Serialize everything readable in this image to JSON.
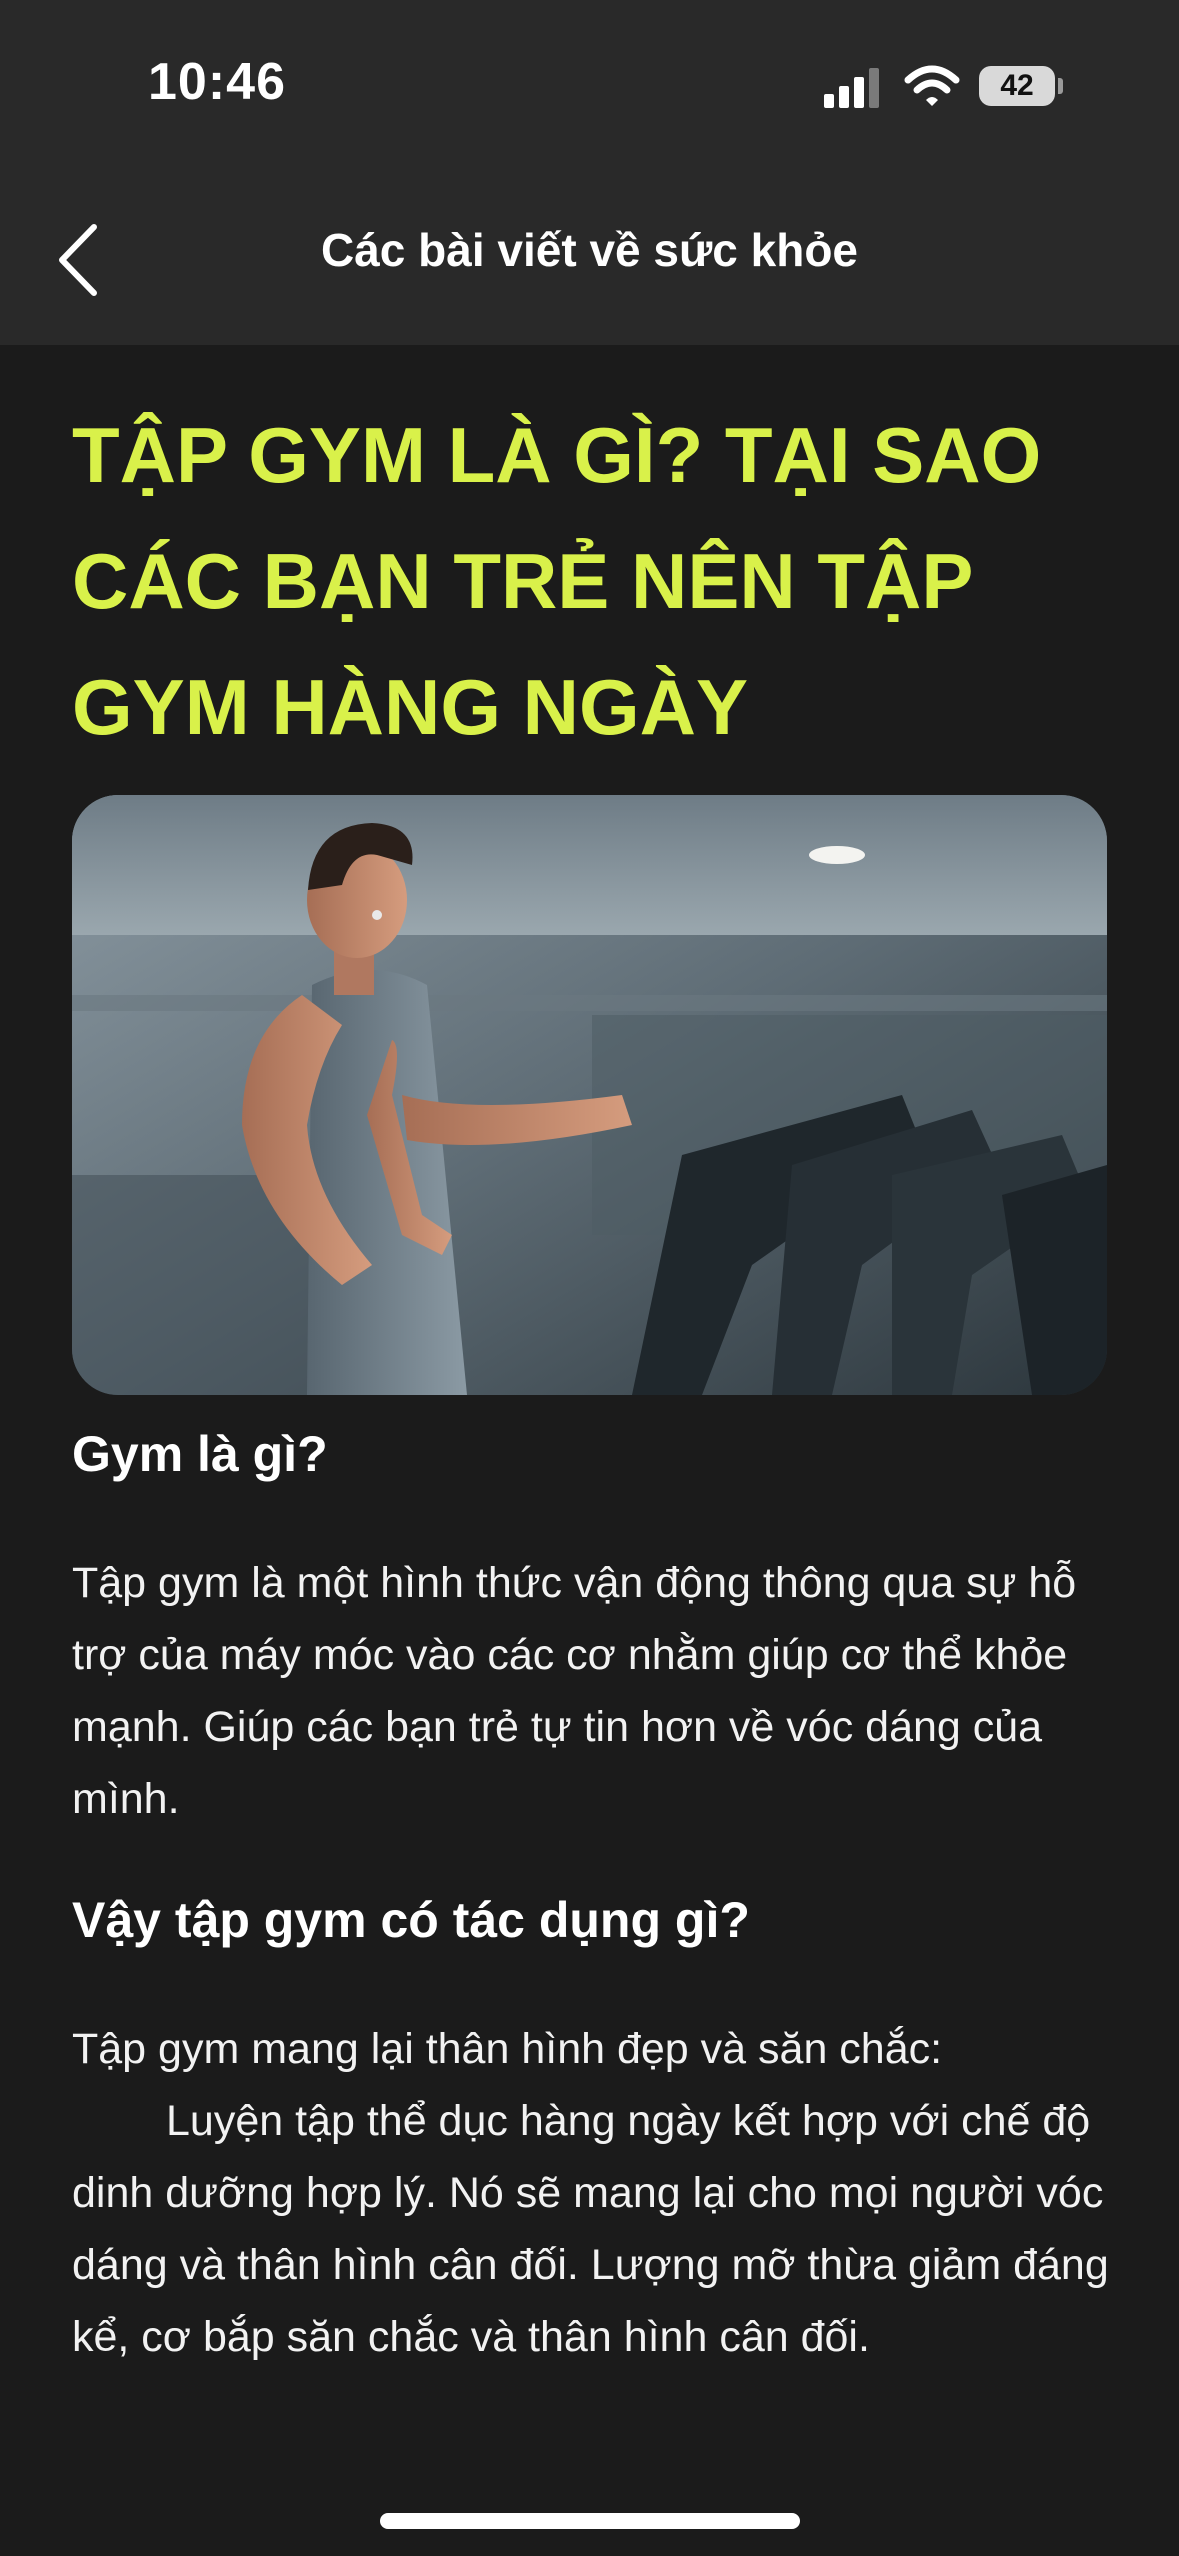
{
  "status_bar": {
    "time": "10:46",
    "battery": "42",
    "icons": [
      "signal-icon",
      "wifi-icon",
      "battery-icon"
    ]
  },
  "nav": {
    "back_icon": "chevron-left-icon",
    "title": "Các bài viết về sức khỏe"
  },
  "article": {
    "headline": "TẬP GYM LÀ GÌ? TẠI SAO CÁC BẠN TRẺ NÊN TẬP GYM HÀNG NGÀY",
    "image_description": "man running on treadmill in gym",
    "section1_heading": "Gym là gì?",
    "section1_text": "Tập gym là một hình thức vận động thông qua sự hỗ trợ của máy móc vào các cơ nhằm giúp cơ thể khỏe mạnh. Giúp các bạn trẻ tự tin hơn về vóc dáng của mình.",
    "section2_heading": "Vậy tập gym có tác dụng gì?",
    "section2_lead": "Tập gym mang lại thân hình đẹp và săn chắc:",
    "section2_text": "Luyện tập thể dục hàng ngày kết hợp với chế độ dinh dưỡng hợp lý. Nó sẽ mang lại cho mọi người vóc dáng và thân hình cân đối. Lượng mỡ thừa giảm đáng kể, cơ bắp săn chắc và thân hình cân đối."
  },
  "colors": {
    "headline": "#d9f14a",
    "background": "#1b1b1b",
    "bars": "#292929"
  }
}
